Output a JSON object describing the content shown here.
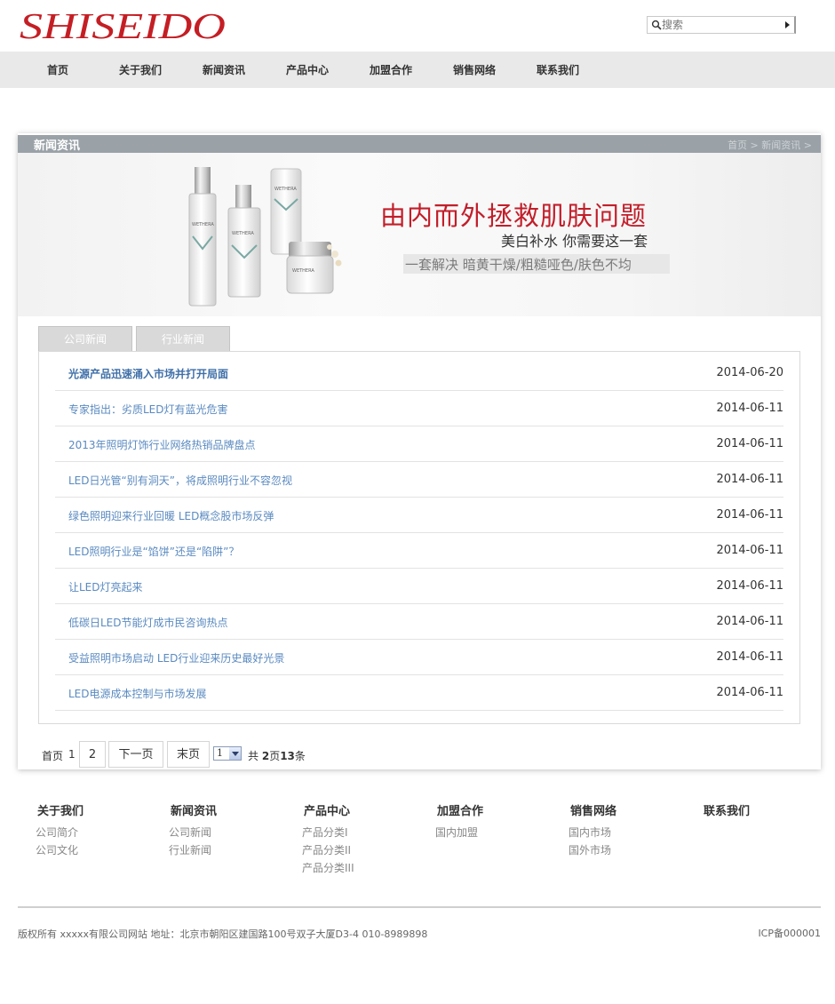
{
  "brand": {
    "logo_text": "SHISEIDO",
    "color": "#c41e24"
  },
  "search": {
    "placeholder": "搜索"
  },
  "nav": [
    "首页",
    "关于我们",
    "新闻资讯",
    "产品中心",
    "加盟合作",
    "销售网络",
    "联系我们"
  ],
  "section": {
    "title": "新闻资讯",
    "breadcrumb": "首页 > 新闻资讯 >"
  },
  "banner": {
    "headline": "由内而外拯救肌肤问题",
    "subline": "美白补水 你需要这一套",
    "tagline": "一套解决 暗黄干燥/粗糙哑色/肤色不均",
    "product_brand": "WETHERA",
    "accent": "#c21e2a"
  },
  "tabs": [
    "公司新闻",
    "行业新闻"
  ],
  "news": [
    {
      "title": "光源产品迅速涌入市场并打开局面",
      "date": "2014-06-20"
    },
    {
      "title": "专家指出：劣质LED灯有蓝光危害",
      "date": "2014-06-11"
    },
    {
      "title": "2013年照明灯饰行业网络热销品牌盘点",
      "date": "2014-06-11"
    },
    {
      "title": "LED日光管“别有洞天”，将成照明行业不容忽视",
      "date": "2014-06-11"
    },
    {
      "title": "绿色照明迎来行业回暖 LED概念股市场反弹",
      "date": "2014-06-11"
    },
    {
      "title": "LED照明行业是“馅饼”还是“陷阱”？",
      "date": "2014-06-11"
    },
    {
      "title": "让LED灯亮起来",
      "date": "2014-06-11"
    },
    {
      "title": "低碳日LED节能灯成市民咨询热点",
      "date": "2014-06-11"
    },
    {
      "title": "受益照明市场启动 LED行业迎来历史最好光景",
      "date": "2014-06-11"
    },
    {
      "title": "LED电源成本控制与市场发展",
      "date": "2014-06-11"
    }
  ],
  "pager": {
    "first": "首页",
    "current": "1",
    "page2": "2",
    "next": "下一页",
    "last": "末页",
    "select_value": "1",
    "summary_prefix": "共 ",
    "pages": "2",
    "pages_unit": "页",
    "total": "13",
    "total_unit": "条"
  },
  "footer": {
    "columns": [
      {
        "heading": "关于我们",
        "items": [
          "公司简介",
          "公司文化"
        ]
      },
      {
        "heading": "新闻资讯",
        "items": [
          "公司新闻",
          "行业新闻"
        ]
      },
      {
        "heading": "产品中心",
        "items": [
          "产品分类I",
          "产品分类II",
          "产品分类III"
        ]
      },
      {
        "heading": "加盟合作",
        "items": [
          "国内加盟"
        ]
      },
      {
        "heading": "销售网络",
        "items": [
          "国内市场",
          "国外市场"
        ]
      },
      {
        "heading": "联系我们",
        "items": []
      }
    ],
    "copyright": "版权所有 xxxxx有限公司网站 地址：北京市朝阳区建国路100号双子大厦D3-4 010-8989898",
    "icp": "ICP备000001"
  }
}
